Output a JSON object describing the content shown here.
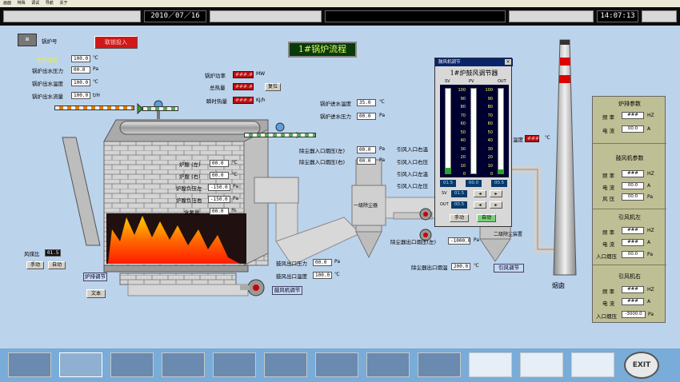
{
  "menu": [
    "画面",
    "特殊",
    "调试",
    "导航",
    "关于"
  ],
  "topbar": {
    "date": "2010／07／16",
    "time": "14:07:13"
  },
  "title": "1#锅炉流程",
  "boiler_id_label": "锅炉号",
  "interlock_button": "联锁投入",
  "left_params": [
    {
      "label": "室外温度",
      "value": "100.0",
      "unit": "℃"
    },
    {
      "label": "锅炉出水压力",
      "value": "00.0",
      "unit": "Pa"
    },
    {
      "label": "锅炉出水温度",
      "value": "100.0",
      "unit": "℃"
    },
    {
      "label": "锅炉出水流量",
      "value": "100.0",
      "unit": "t/H"
    }
  ],
  "power": {
    "label1": "锅炉功率",
    "val1": "###.#",
    "unit1": "MW",
    "label2": "总热量",
    "val2": "###.#",
    "btn": "复位",
    "label3": "瞬时热量",
    "val3": "###.#",
    "unit3": "KJ/h"
  },
  "inlet": [
    {
      "label": "锅炉进水温度",
      "value": "35.0",
      "unit": "℃"
    },
    {
      "label": "锅炉进水压力",
      "value": "00.0",
      "unit": "Pa"
    }
  ],
  "furnace": [
    {
      "label": "炉膛 (左)",
      "value": "00.0",
      "unit": "℃"
    },
    {
      "label": "炉膛 (右)",
      "value": "00.0",
      "unit": "℃"
    },
    {
      "label": "炉膛负压左",
      "value": "-150.0",
      "unit": "Pa"
    },
    {
      "label": "炉膛负压右",
      "value": "-150.0",
      "unit": "Pa"
    },
    {
      "label": "含氧量",
      "value": "00.0",
      "unit": "%"
    }
  ],
  "dust_inlet": [
    {
      "label": "除尘器入口烟压(左)",
      "value": "00.0",
      "unit": "Pa"
    },
    {
      "label": "除尘器入口烟压(右)",
      "value": "00.0",
      "unit": "Pa"
    }
  ],
  "fan_inlet": [
    {
      "label": "引风入口右温",
      "value": "00.0",
      "unit": "℃"
    },
    {
      "label": "引风入口右压",
      "value": "00.0",
      "unit": "Pa"
    },
    {
      "label": "引风入口左温",
      "value": "00.0",
      "unit": "℃"
    },
    {
      "label": "引风入口左压",
      "value": "00.0",
      "unit": "Pa"
    }
  ],
  "exhaust_temp": {
    "label": "温度",
    "value": "###",
    "unit": "℃"
  },
  "coal_ratio": {
    "label": "风煤比",
    "value": "01.5"
  },
  "manual_btn": "手动",
  "auto_btn": "自动",
  "furnace_adjust": "炉排调节",
  "text_btn": "文本",
  "blower_outlet": [
    {
      "label": "鼓风出口压力",
      "value": "00.0",
      "unit": "Pa"
    },
    {
      "label": "鼓风出口温度",
      "value": "100.0",
      "unit": "℃"
    }
  ],
  "blower_adjust": "鼓风机调节",
  "dust_outlet": [
    {
      "label": "除尘器出口烟压(左)",
      "value": "-1000.0",
      "unit": "Pa"
    },
    {
      "label": "除尘器出口烟温",
      "value": "200.0",
      "unit": "℃"
    }
  ],
  "induced_adjust": "引风调节",
  "dust1_label": "一级除尘器",
  "dust2_label": "二级除尘装置",
  "chimney_label": "烟囱",
  "controller": {
    "window_title": "鼓风机调节",
    "heading": "1#炉鼓风调节器",
    "cols": [
      "SV",
      "PV",
      "OUT"
    ],
    "scale": [
      "100",
      "90",
      "80",
      "70",
      "60",
      "50",
      "40",
      "30",
      "20",
      "10",
      "0"
    ],
    "readouts": [
      "01.5",
      "00.0",
      "00.5"
    ],
    "sv_label": "SV",
    "sv_value": "01.5",
    "out_label": "OUT",
    "out_value": "00.5",
    "manual": "手动",
    "auto": "自动"
  },
  "right_panel": {
    "grate_title": "炉排参数",
    "grate_items": [
      {
        "label": "频 率",
        "value": "###",
        "unit": "HZ"
      },
      {
        "label": "电 流",
        "value": "00.0",
        "unit": "A"
      }
    ],
    "blower_title": "鼓风机参数",
    "blower_items": [
      {
        "label": "频 率",
        "value": "###",
        "unit": "HZ"
      },
      {
        "label": "电 流",
        "value": "00.0",
        "unit": "A"
      },
      {
        "label": "风 压",
        "value": "00.0",
        "unit": "Pa"
      }
    ],
    "left_fan_title": "引风机左",
    "left_fan_items": [
      {
        "label": "频 率",
        "value": "###",
        "unit": "HZ"
      },
      {
        "label": "电 流",
        "value": "###",
        "unit": "A"
      },
      {
        "label": "入口烟压",
        "value": "00.0",
        "unit": "Pa"
      }
    ],
    "right_fan_title": "引风机右",
    "right_fan_items": [
      {
        "label": "频 率",
        "value": "###",
        "unit": "HZ"
      },
      {
        "label": "电 流",
        "value": "###",
        "unit": "A"
      },
      {
        "label": "入口烟压",
        "value": "-3000.0",
        "unit": "Pa"
      }
    ]
  },
  "exit_label": "EXIT"
}
